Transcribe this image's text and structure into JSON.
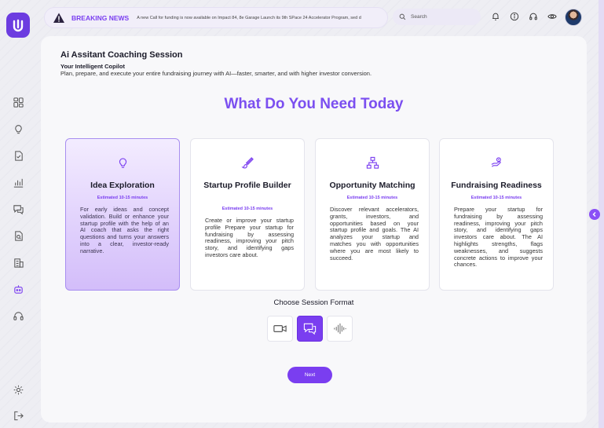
{
  "topbar": {
    "breaking_label": "BREAKING NEWS",
    "ticker_text": "A new Call for funding is now available on Impact 84, 8e Garage Launch its 9th SPace 24 Accelerator Program, sed d",
    "search_placeholder": "Search"
  },
  "header": {
    "title": "Ai Assitant Coaching Session",
    "subtitle": "Your Intelligent Copilot",
    "description": "Plan, prepare, and execute your entire fundraising journey with AI—faster, smarter, and with higher investor conversion."
  },
  "main_title": "What Do You Need Today",
  "cards": [
    {
      "title": "Idea Exploration",
      "estimate": "Estimated 10-15 minutes",
      "description": "For early ideas and concept validation. Build or enhance your startup profile with the help of an AI coach that asks the right questions and turns your answers into a clear, investor-ready narrative."
    },
    {
      "title": "Startup Profile Builder",
      "estimate": "Estimated 10-15 minutes",
      "description": "Create or improve your startup profile Prepare your startup for fundraising by assessing readiness, improving your pitch story, and identifying gaps investors care about."
    },
    {
      "title": "Opportunity Matching",
      "estimate": "Estimated 10-15 minutes",
      "description": "Discover relevant accelerators, grants, investors, and opportunities based on your startup profile and goals. The AI analyzes your startup and matches you with opportunities where you are most likely to succeed."
    },
    {
      "title": "Fundraising Readiness",
      "estimate": "Estimated 10-15 minutes",
      "description": "Prepare your startup for fundraising by assessing readiness, improving your pitch story, and identifying gaps investors care about. The AI highlights strengths, flags weaknesses, and suggests concrete actions to improve your chances."
    }
  ],
  "format": {
    "title": "Choose Session Format",
    "options": [
      "video-icon",
      "chat-icon",
      "voice-wave-icon"
    ],
    "selected": "chat-icon"
  },
  "next_label": "Next",
  "colors": {
    "accent": "#7a3ef0",
    "title_accent": "#7b4ff0"
  }
}
